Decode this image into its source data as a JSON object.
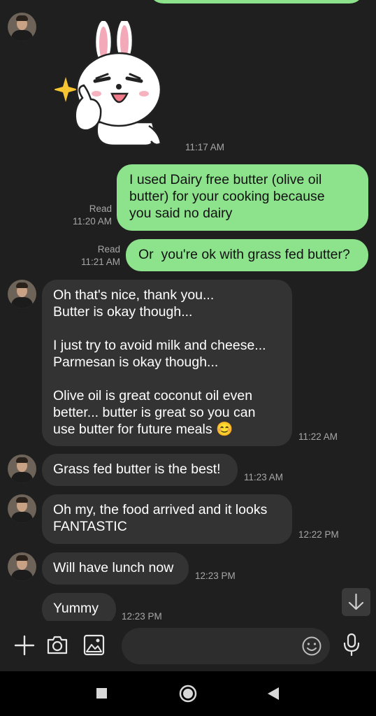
{
  "messages": {
    "sticker_time": "11:17 AM",
    "out1": {
      "text": "I used Dairy free butter (olive oil\nbutter) for your cooking because\nyou said no dairy",
      "status": "Read",
      "time": "11:20 AM"
    },
    "out2": {
      "text": "Or  you're ok with grass fed butter?",
      "status": "Read",
      "time": "11:21 AM"
    },
    "in1": {
      "text": "Oh that's nice, thank you...\nButter is okay though...\n\nI just try to avoid milk and cheese...\nParmesan is okay though...\n\nOlive oil is great coconut oil even\nbetter... butter is great so you can\nuse butter for future meals 😊",
      "time": "11:22 AM"
    },
    "in2": {
      "text": "Grass fed butter is the best!",
      "time": "11:23 AM"
    },
    "in3": {
      "text": "Oh my, the food arrived and it looks\nFANTASTIC",
      "time": "12:22 PM"
    },
    "in4": {
      "text": "Will have lunch now",
      "time": "12:23 PM"
    },
    "in5": {
      "text": "Yummy",
      "time": "12:23 PM"
    }
  },
  "toolbar": {
    "icons": [
      "plus-icon",
      "camera-icon",
      "image-icon",
      "emoji-icon",
      "microphone-icon"
    ],
    "input_value": ""
  },
  "colors": {
    "outgoing_bubble": "#8de38c",
    "incoming_bubble": "#333333",
    "background": "#1f1f1f"
  }
}
